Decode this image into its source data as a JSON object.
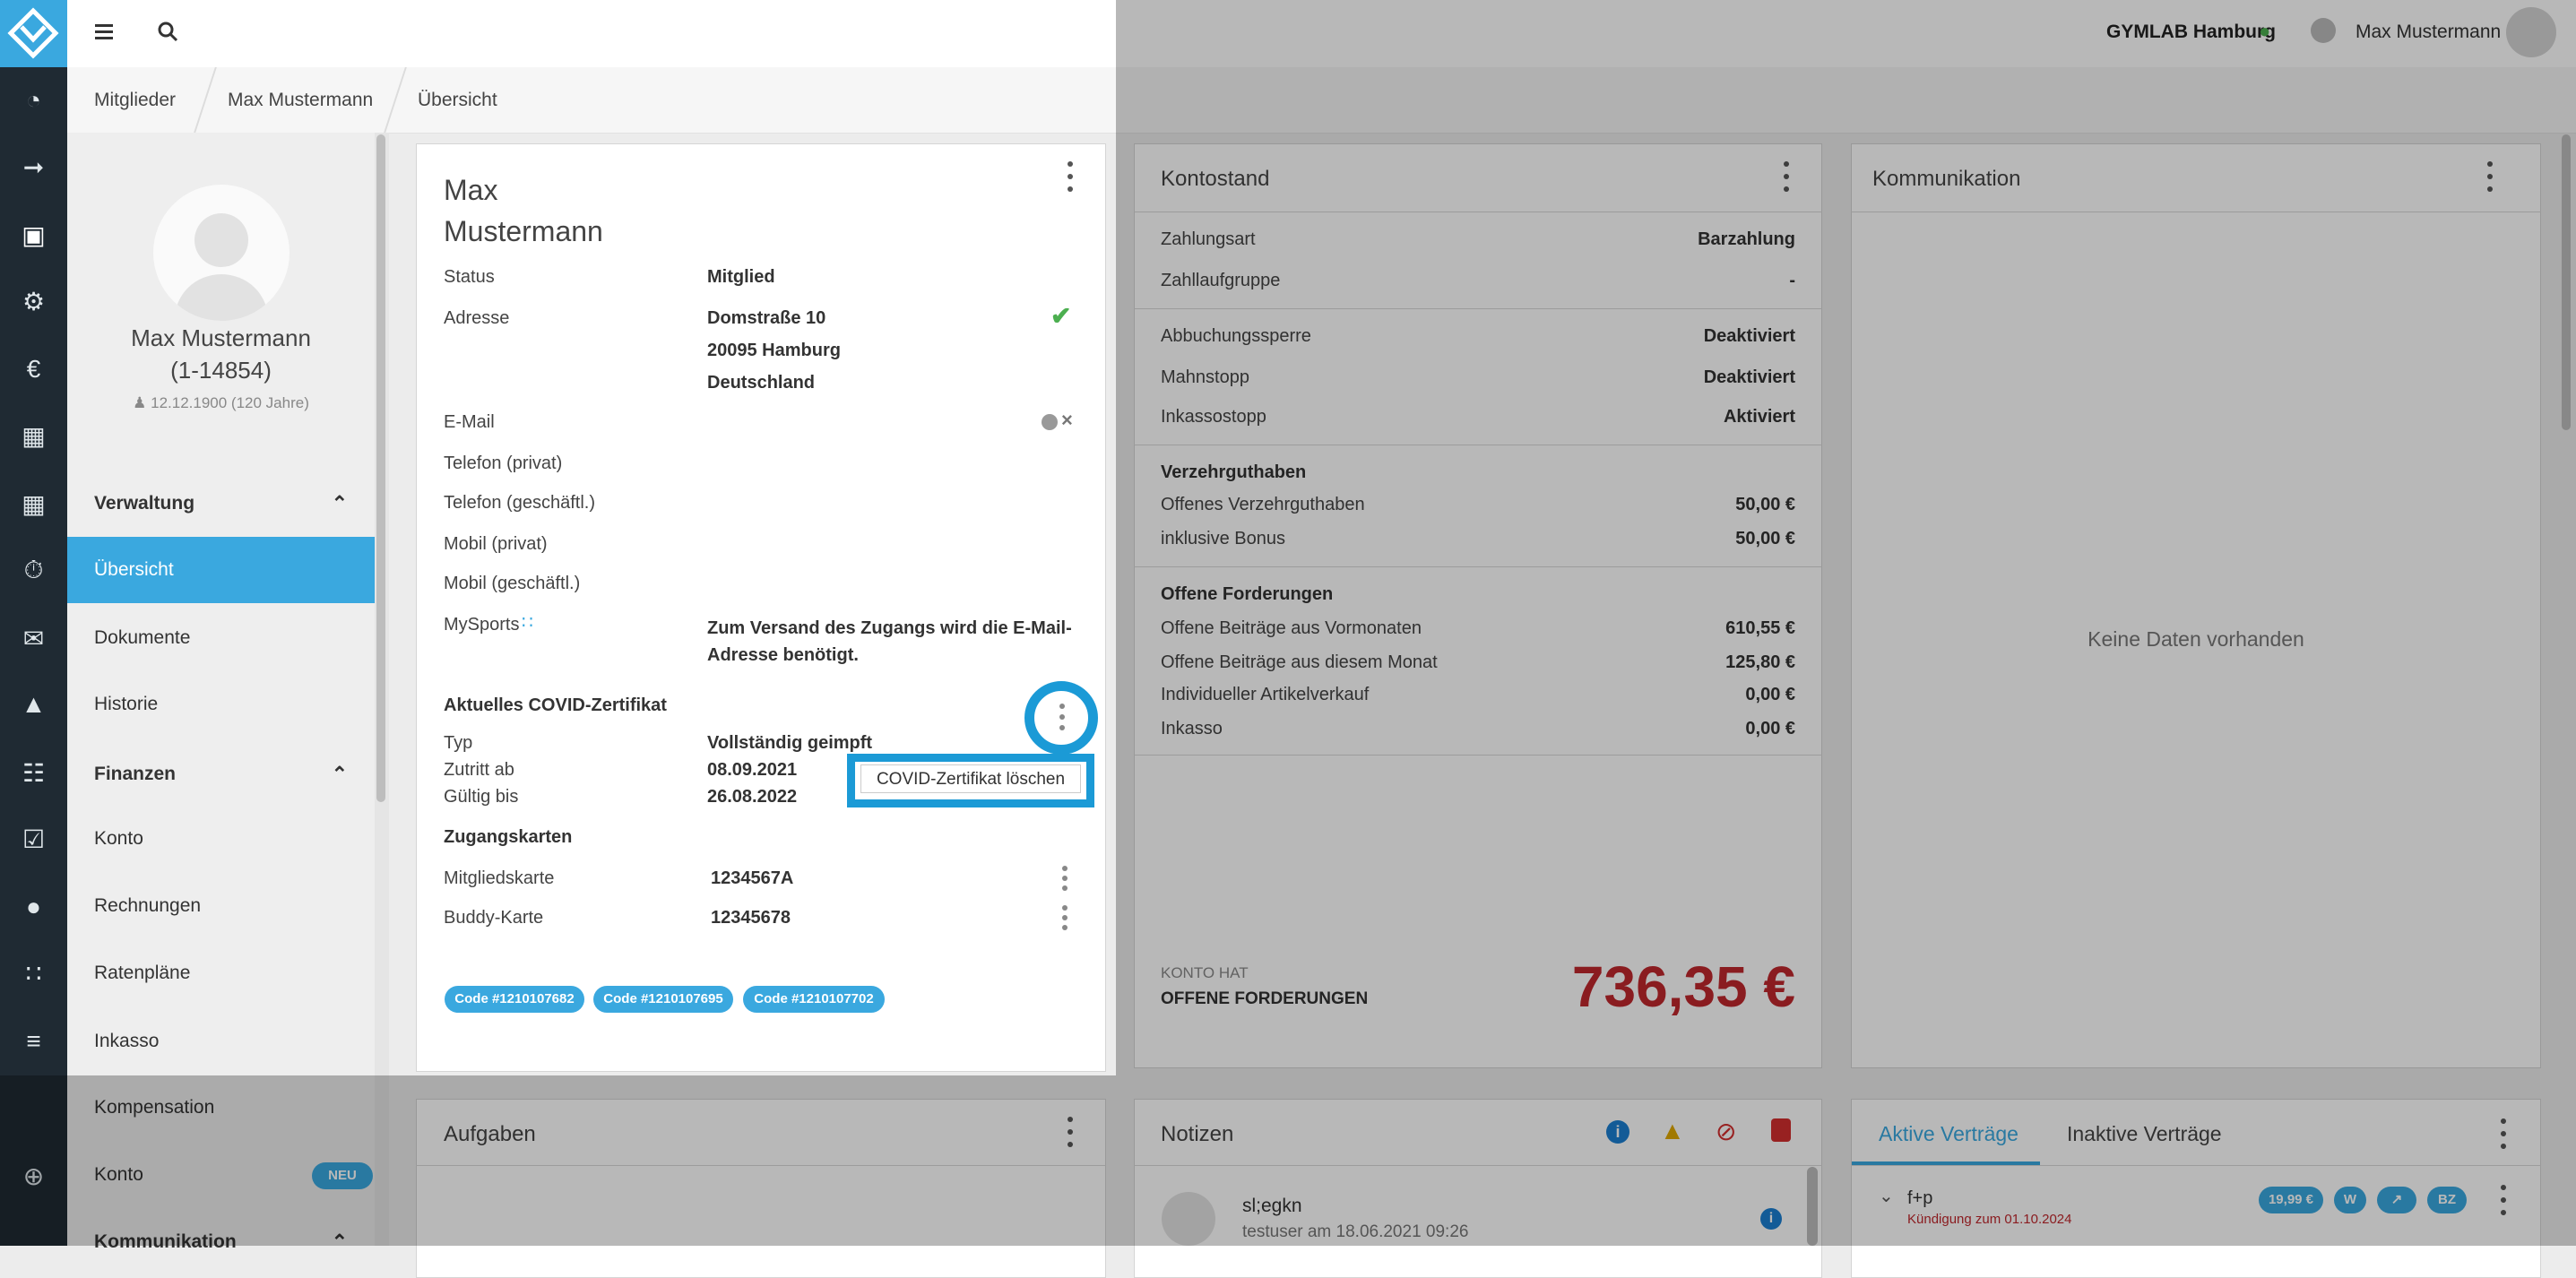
{
  "topbar": {
    "location": "GYMLAB Hamburg",
    "user": "Max Mustermann"
  },
  "breadcrumb": [
    "Mitglieder",
    "Max Mustermann",
    "Übersicht"
  ],
  "profile": {
    "name": "Max Mustermann",
    "id": "(1-14854)",
    "birth": "12.12.1900 (120 Jahre)"
  },
  "sidebar": {
    "verwaltung": "Verwaltung",
    "uebersicht": "Übersicht",
    "dokumente": "Dokumente",
    "historie": "Historie",
    "finanzen": "Finanzen",
    "konto": "Konto",
    "rechnungen": "Rechnungen",
    "ratenplaene": "Ratenpläne",
    "inkasso": "Inkasso",
    "kompensation": "Kompensation",
    "konto2": "Konto",
    "neu_badge": "NEU",
    "kommunikation": "Kommunikation"
  },
  "member": {
    "first": "Max",
    "last": "Mustermann",
    "status_label": "Status",
    "status_value": "Mitglied",
    "adresse_label": "Adresse",
    "adresse_1": "Domstraße 10",
    "adresse_2": "20095 Hamburg",
    "adresse_3": "Deutschland",
    "email_label": "E-Mail",
    "tel_privat_label": "Telefon (privat)",
    "tel_geschaeft_label": "Telefon (geschäftl.)",
    "mobil_privat_label": "Mobil (privat)",
    "mobil_geschaeft_label": "Mobil (geschäftl.)",
    "mysports_label": "MySports",
    "mysports_value": "Zum Versand des Zugangs wird die E-Mail-Adresse benötigt.",
    "covid_title": "Aktuelles COVID-Zertifikat",
    "typ_label": "Typ",
    "typ_value": "Vollständig geimpft",
    "zutritt_label": "Zutritt ab",
    "zutritt_value": "08.09.2021",
    "gueltig_label": "Gültig bis",
    "gueltig_value": "26.08.2022",
    "covid_delete": "COVID-Zertifikat löschen",
    "zugang_title": "Zugangskarten",
    "card1_label": "Mitgliedskarte",
    "card1_value": "1234567A",
    "card2_label": "Buddy-Karte",
    "card2_value": "12345678",
    "codes": [
      "Code #1210107682",
      "Code #1210107695",
      "Code #1210107702"
    ]
  },
  "konto": {
    "title": "Kontostand",
    "zahlungsart_label": "Zahlungsart",
    "zahlungsart_value": "Barzahlung",
    "zahllauf_label": "Zahllaufgruppe",
    "zahllauf_value": "-",
    "abbuchung_label": "Abbuchungssperre",
    "abbuchung_value": "Deaktiviert",
    "mahnstopp_label": "Mahnstopp",
    "mahnstopp_value": "Deaktiviert",
    "inkassostopp_label": "Inkassostopp",
    "inkassostopp_value": "Aktiviert",
    "verzehr_title": "Verzehrguthaben",
    "offen_verzehr_label": "Offenes Verzehrguthaben",
    "offen_verzehr_value": "50,00 €",
    "bonus_label": "inklusive Bonus",
    "bonus_value": "50,00 €",
    "forderungen_title": "Offene Forderungen",
    "vormonat_label": "Offene Beiträge aus Vormonaten",
    "vormonat_value": "610,55 €",
    "diesermonat_label": "Offene Beiträge aus diesem Monat",
    "diesermonat_value": "125,80 €",
    "artikel_label": "Individueller Artikelverkauf",
    "artikel_value": "0,00 €",
    "inkasso_label": "Inkasso",
    "inkasso_value": "0,00 €",
    "konto_hat": "KONTO HAT",
    "offene_forderungen": "OFFENE FORDERUNGEN",
    "total": "736,35 €",
    "total_color": "#c0272d"
  },
  "kommunikation": {
    "title": "Kommunikation",
    "empty": "Keine Daten vorhanden"
  },
  "aufgaben": {
    "title": "Aufgaben"
  },
  "notizen": {
    "title": "Notizen",
    "note_title": "sl;egkn",
    "note_meta": "testuser am 18.06.2021 09:26"
  },
  "vertraege": {
    "tab_active": "Aktive Verträge",
    "tab_inactive": "Inaktive Verträge",
    "contract_name": "f+p",
    "kuendigung": "Kündigung zum 01.10.2024",
    "price": "19,99 €",
    "badge_w": "W",
    "badge_bz": "BZ"
  },
  "colors": {
    "accent": "#3aa8df",
    "rail": "#1f2a33",
    "danger": "#c0272d",
    "success": "#4caf50"
  }
}
